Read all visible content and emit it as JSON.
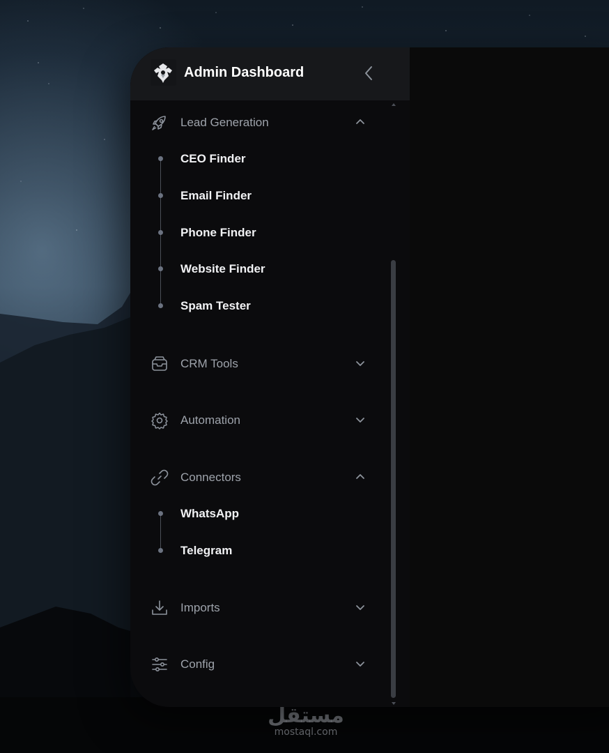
{
  "app": {
    "title": "Admin Dashboard"
  },
  "sidebar": {
    "groups": [
      {
        "label": "Lead Generation",
        "icon": "rocket-icon",
        "expanded": true,
        "children": [
          "CEO Finder",
          "Email Finder",
          "Phone Finder",
          "Website Finder",
          "Spam Tester"
        ]
      },
      {
        "label": "CRM Tools",
        "icon": "inbox-icon",
        "expanded": false,
        "children": []
      },
      {
        "label": "Automation",
        "icon": "gear-icon",
        "expanded": false,
        "children": []
      },
      {
        "label": "Connectors",
        "icon": "link-icon",
        "expanded": true,
        "children": [
          "WhatsApp",
          "Telegram"
        ]
      },
      {
        "label": "Imports",
        "icon": "download-icon",
        "expanded": false,
        "children": []
      },
      {
        "label": "Config",
        "icon": "sliders-icon",
        "expanded": false,
        "children": []
      }
    ]
  },
  "watermark": {
    "arabic": "مستقل",
    "latin": "mostaql.com"
  },
  "colors": {
    "sidebar_bg": "#0b0b0d",
    "header_bg": "#17181b",
    "text_primary": "#f1f2f4",
    "text_muted": "#9ea3ab",
    "tree_line": "#4b4f57",
    "scrollbar": "#3a3d43"
  }
}
